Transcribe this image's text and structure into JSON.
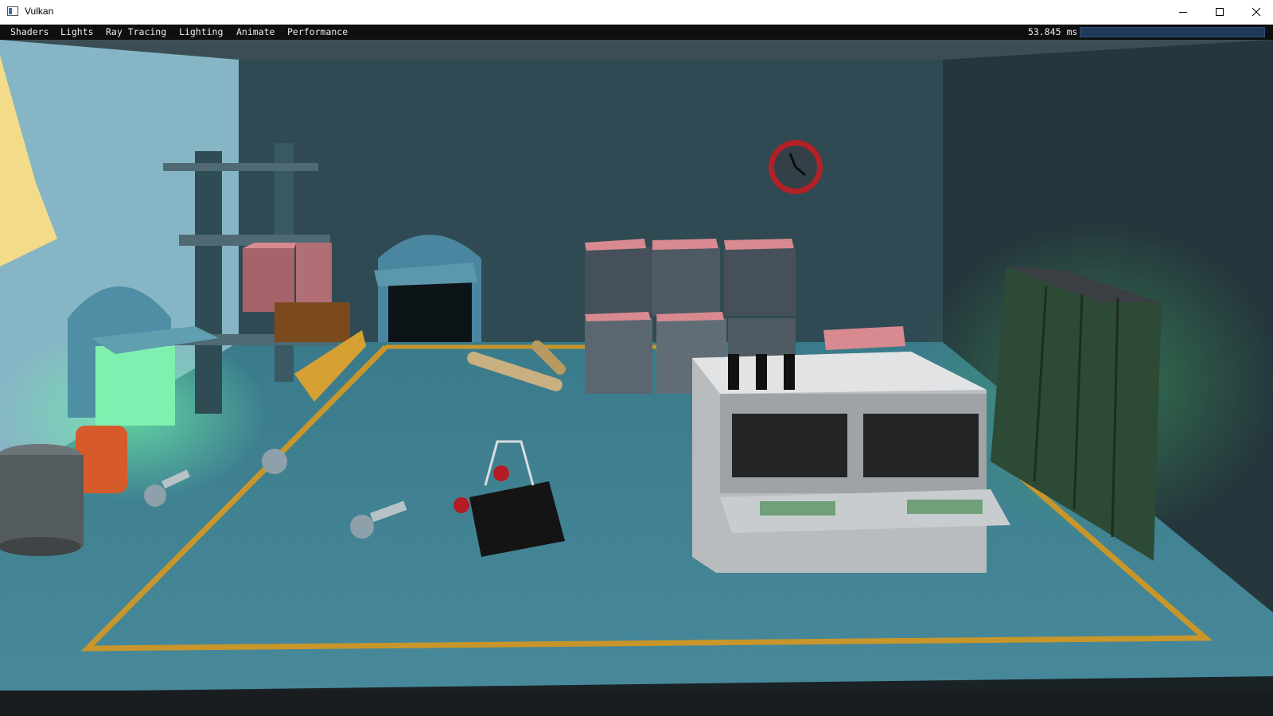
{
  "window": {
    "title": "Vulkan"
  },
  "menu": {
    "items": [
      "Shaders",
      "Lights",
      "Ray Tracing",
      "Lighting",
      "Animate",
      "Performance"
    ]
  },
  "stats": {
    "frame_time": "53.845 ms"
  },
  "colors": {
    "floor": "#3d7f8f",
    "back_wall": "#2f4a52",
    "left_wall": "#85b5c4",
    "right_wall": "#26383e",
    "floor_tape": "#c8962a",
    "crate_top": "#d98a90",
    "menubar": "#0f0f0f"
  },
  "icons": {
    "app": "app-icon",
    "minimize": "minimize-icon",
    "maximize": "maximize-icon",
    "close": "close-icon"
  }
}
